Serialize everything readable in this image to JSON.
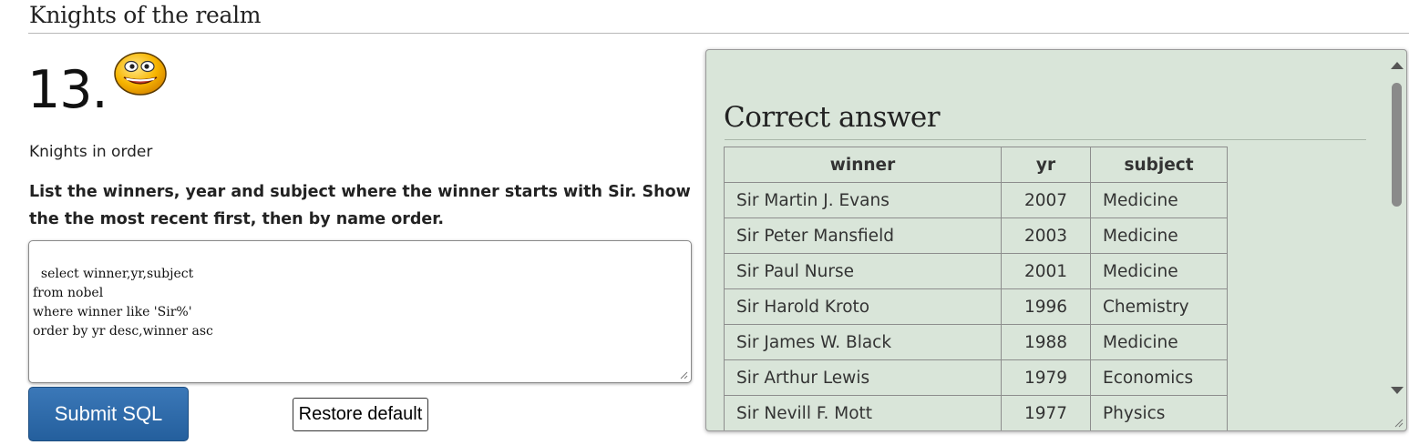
{
  "page": {
    "title": "Knights of the realm"
  },
  "question": {
    "number": "13.",
    "topic": "Knights in order",
    "description": "List the winners, year and subject where the winner starts with Sir. Show the the most recent first, then by name order."
  },
  "editor": {
    "sql": "select winner,yr,subject\nfrom nobel\nwhere winner like 'Sir%'\norder by yr desc,winner asc"
  },
  "buttons": {
    "submit_label": "Submit SQL",
    "restore_label": "Restore default"
  },
  "answer": {
    "heading": "Correct answer",
    "columns": [
      "winner",
      "yr",
      "subject"
    ],
    "rows": [
      [
        "Sir Martin J. Evans",
        "2007",
        "Medicine"
      ],
      [
        "Sir Peter Mansfield",
        "2003",
        "Medicine"
      ],
      [
        "Sir Paul Nurse",
        "2001",
        "Medicine"
      ],
      [
        "Sir Harold Kroto",
        "1996",
        "Chemistry"
      ],
      [
        "Sir James W. Black",
        "1988",
        "Medicine"
      ],
      [
        "Sir Arthur Lewis",
        "1979",
        "Economics"
      ],
      [
        "Sir Nevill F. Mott",
        "1977",
        "Physics"
      ]
    ]
  },
  "icons": {
    "status": "smiley-face-icon"
  },
  "colors": {
    "panel_bg": "#d9e5d9",
    "submit_bg": "#2d6aa8"
  }
}
